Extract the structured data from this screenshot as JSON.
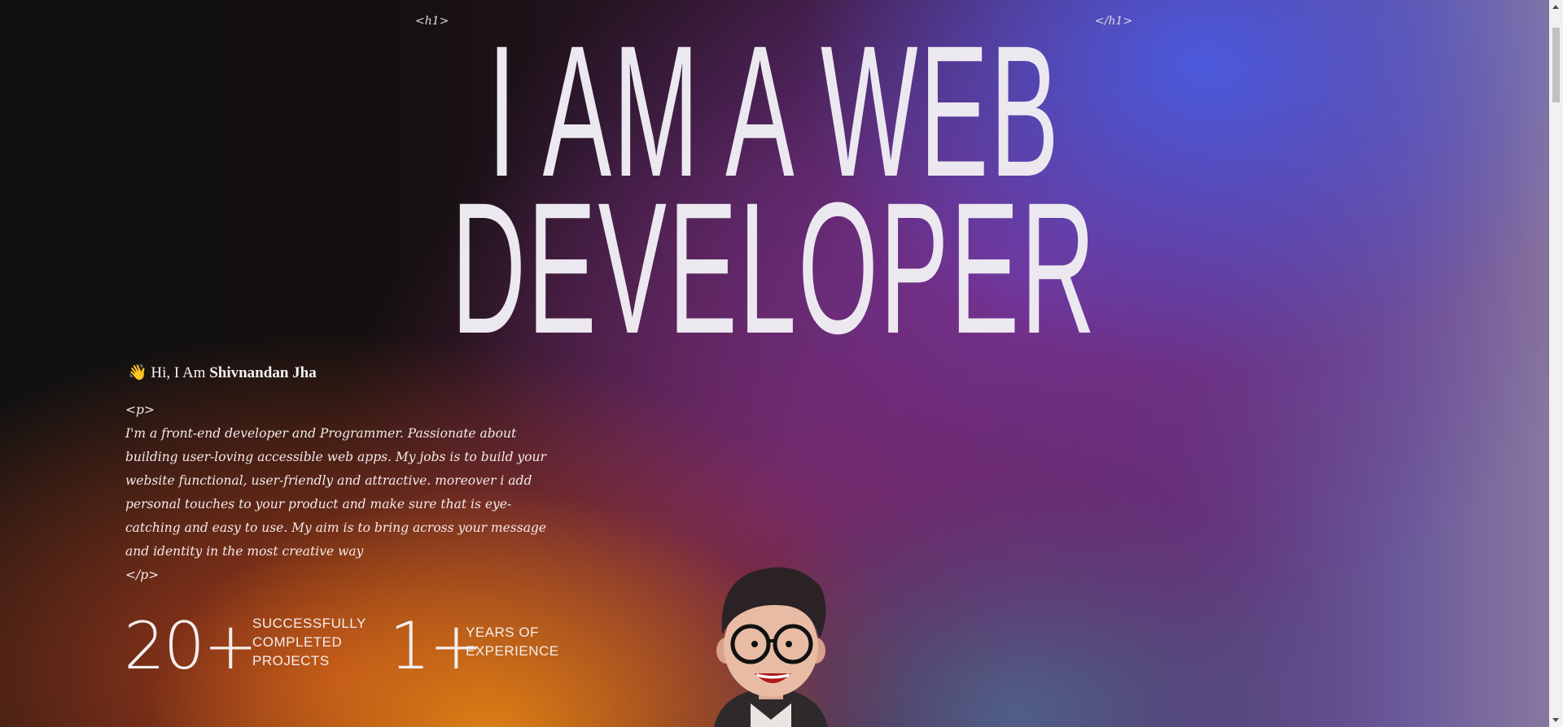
{
  "hero": {
    "open_tag": "<h1>",
    "close_tag": "</h1>",
    "title_line1": "I AM A WEB",
    "title_line2": "DEVELOPER"
  },
  "intro": {
    "wave_icon": "👋",
    "greeting": "Hi, I Am",
    "name": "Shivnandan Jha"
  },
  "about": {
    "open_tag": "<p>",
    "text": "I'm a front-end developer and Programmer. Passionate about building user-loving accessible web apps. My jobs is to build your website functional, user-friendly and attractive. moreover i add personal touches to your product and make sure that is eye-catching and easy to use. My aim is to bring across your message and identity in the most creative way",
    "close_tag": "</p>"
  },
  "stats": [
    {
      "value": "20+",
      "label": "SUCCESSFULLY COMPLETED PROJECTS"
    },
    {
      "value": "1+",
      "label": "YEARS OF EXPERIENCE"
    }
  ]
}
